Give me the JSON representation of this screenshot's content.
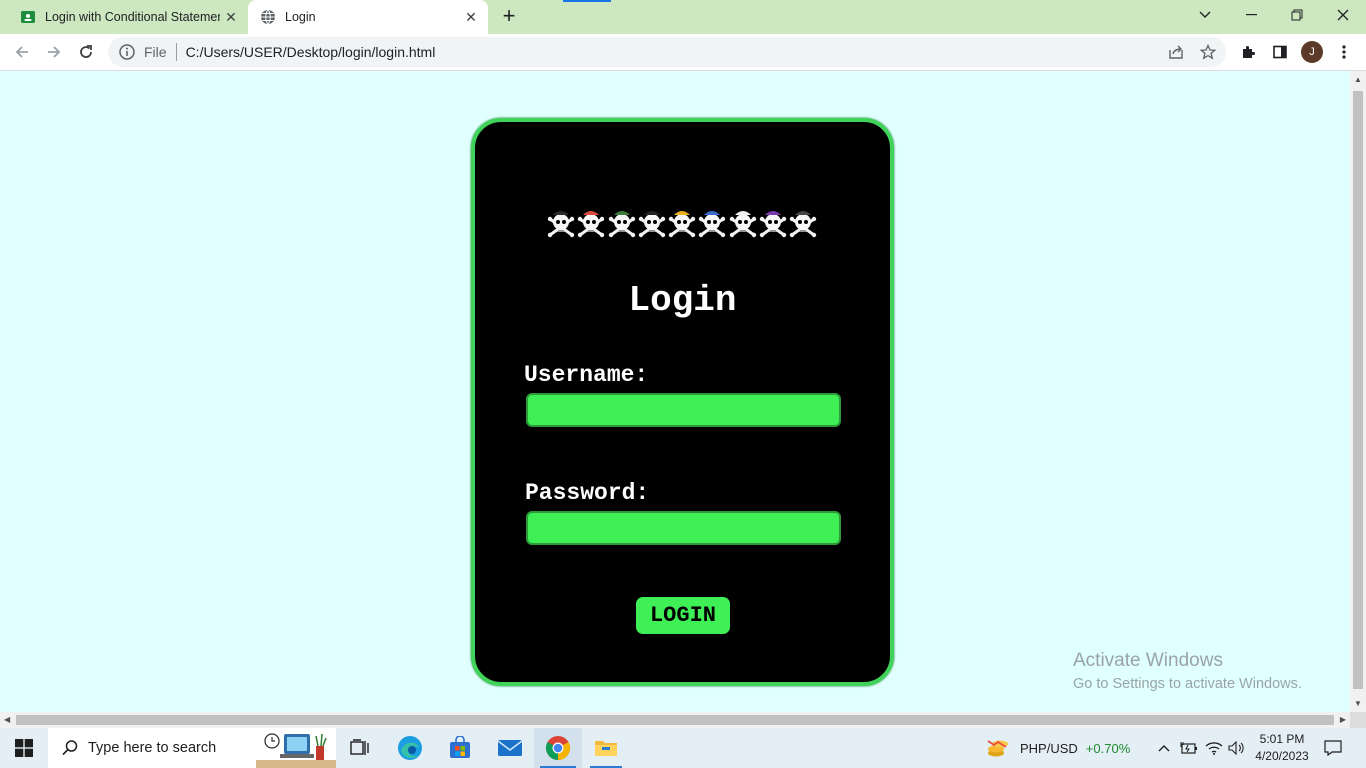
{
  "browser": {
    "tabs": [
      {
        "title": "Login with Conditional Statement",
        "active": false
      },
      {
        "title": "Login",
        "active": true
      }
    ],
    "address": {
      "scheme_label": "File",
      "url": "C:/Users/USER/Desktop/login/login.html"
    },
    "profile_initial": "J"
  },
  "page": {
    "title": "Login",
    "username_label": "Username:",
    "password_label": "Password:",
    "username_value": "",
    "password_value": "",
    "login_button": "LOGIN",
    "jolly_rogers_count": 9
  },
  "watermark": {
    "line1": "Activate Windows",
    "line2": "Go to Settings to activate Windows."
  },
  "taskbar": {
    "search_placeholder": "Type here to search",
    "ticker_symbol": "PHP/USD",
    "ticker_change": "+0.70%",
    "time": "5:01 PM",
    "date": "4/20/2023"
  },
  "colors": {
    "page_background": "#e0ffff",
    "card_background": "#000000",
    "accent_green": "#3ef055",
    "tabstrip": "#cde8c0",
    "ticker_positive": "#1e8a2e"
  }
}
